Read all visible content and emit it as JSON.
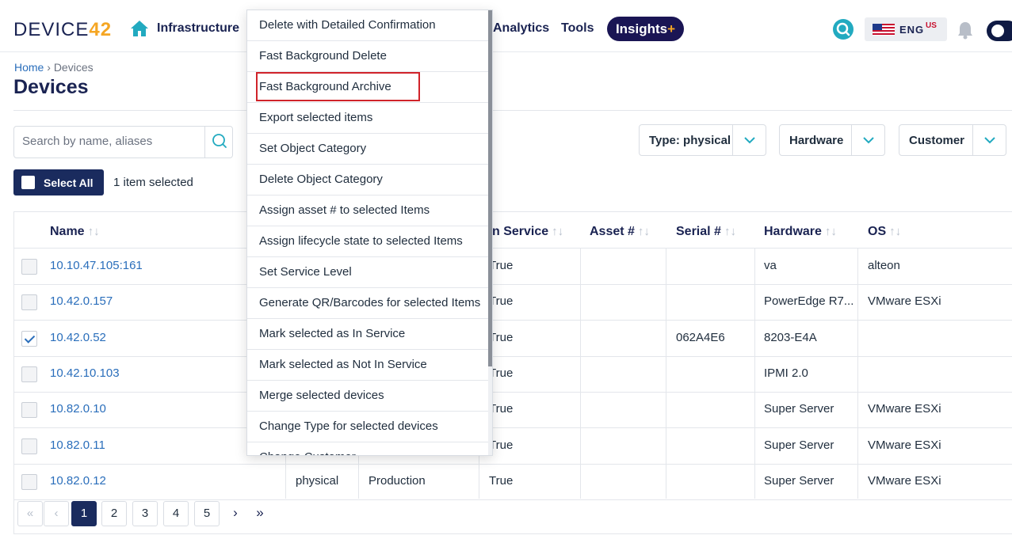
{
  "nav": {
    "logo_text": "DEVICE",
    "logo_num": "42",
    "items": [
      "Infrastructure",
      "Analytics",
      "Tools"
    ],
    "insights": "Insights",
    "insights_plus": "+",
    "lang": "ENG",
    "lang_sup": "US",
    "icons": [
      "home-icon",
      "search-icon",
      "us-flag-icon",
      "bell-icon",
      "toggle-icon"
    ],
    "colors": {
      "brand": "#1a2352",
      "accent": "#f5a623",
      "search": "#22aac0"
    }
  },
  "breadcrumb": {
    "home": "Home",
    "sep": "›",
    "current": "Devices"
  },
  "page_title": "Devices",
  "search": {
    "placeholder": "Search by name, aliases"
  },
  "filters": [
    "Type: physical",
    "Hardware",
    "Customer"
  ],
  "selection": {
    "select_all": "Select All",
    "count_text": "1 item selected"
  },
  "table": {
    "columns": [
      "Name",
      "n Service",
      "Asset #",
      "Serial #",
      "Hardware",
      "OS"
    ],
    "rows": [
      {
        "checked": false,
        "name": "10.10.47.105:161",
        "type": "",
        "service_level": "",
        "in_service": "True",
        "asset": "",
        "serial": "",
        "hardware": "va",
        "os": "alteon"
      },
      {
        "checked": false,
        "name": "10.42.0.157",
        "type": "",
        "service_level": "",
        "in_service": "True",
        "asset": "",
        "serial": "",
        "hardware": "PowerEdge R7...",
        "os": "VMware ESXi"
      },
      {
        "checked": true,
        "name": "10.42.0.52",
        "type": "",
        "service_level": "",
        "in_service": "True",
        "asset": "",
        "serial": "062A4E6",
        "hardware": "8203-E4A",
        "os": ""
      },
      {
        "checked": false,
        "name": "10.42.10.103",
        "type": "",
        "service_level": "",
        "in_service": "True",
        "asset": "",
        "serial": "",
        "hardware": "IPMI 2.0",
        "os": ""
      },
      {
        "checked": false,
        "name": "10.82.0.10",
        "type": "",
        "service_level": "",
        "in_service": "True",
        "asset": "",
        "serial": "",
        "hardware": "Super Server",
        "os": "VMware ESXi"
      },
      {
        "checked": false,
        "name": "10.82.0.11",
        "type": "",
        "service_level": "",
        "in_service": "True",
        "asset": "",
        "serial": "",
        "hardware": "Super Server",
        "os": "VMware ESXi"
      },
      {
        "checked": false,
        "name": "10.82.0.12",
        "type": "physical",
        "service_level": "Production",
        "in_service": "True",
        "asset": "",
        "serial": "",
        "hardware": "Super Server",
        "os": "VMware ESXi"
      }
    ]
  },
  "pagination": {
    "first": "«",
    "prev": "‹",
    "pages": [
      "1",
      "2",
      "3",
      "4",
      "5"
    ],
    "active": "1",
    "next": "›",
    "last": "»"
  },
  "menu": {
    "items": [
      "Delete with Detailed Confirmation",
      "Fast Background Delete",
      "Fast Background Archive",
      "Export selected items",
      "Set Object Category",
      "Delete Object Category",
      "Assign asset # to selected Items",
      "Assign lifecycle state to selected Items",
      "Set Service Level",
      "Generate QR/Barcodes for selected Items",
      "Mark selected as In Service",
      "Mark selected as Not In Service",
      "Merge selected devices",
      "Change Type for selected devices",
      "Change Customer"
    ],
    "highlighted": "Fast Background Archive",
    "highlight_color": "#d0232a"
  }
}
